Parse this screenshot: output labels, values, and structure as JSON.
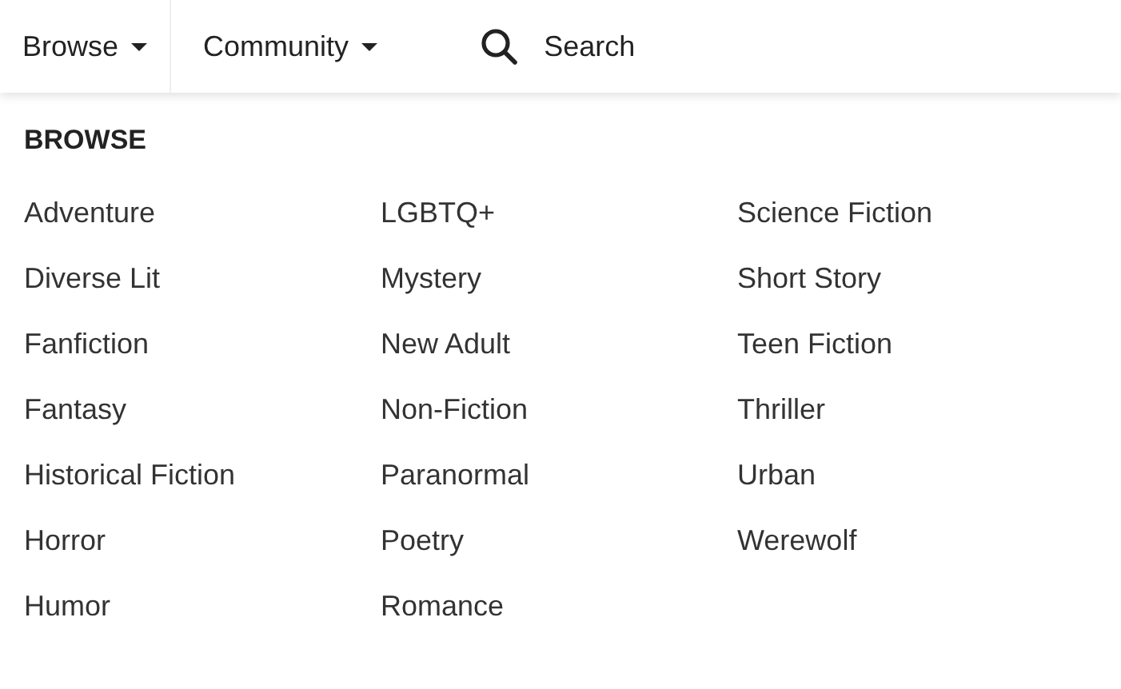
{
  "nav": {
    "tabs": [
      {
        "label": "Browse",
        "selected": true
      },
      {
        "label": "Community",
        "selected": false
      }
    ],
    "search": {
      "placeholder": "Search"
    }
  },
  "dropdown": {
    "heading": "BROWSE",
    "columns": [
      {
        "items": [
          "Adventure",
          "Diverse Lit",
          "Fanfiction",
          "Fantasy",
          "Historical Fiction",
          "Horror",
          "Humor"
        ]
      },
      {
        "items": [
          "LGBTQ+",
          "Mystery",
          "New Adult",
          "Non-Fiction",
          "Paranormal",
          "Poetry",
          "Romance"
        ]
      },
      {
        "items": [
          "Science Fiction",
          "Short Story",
          "Teen Fiction",
          "Thriller",
          "Urban",
          "Werewolf"
        ]
      }
    ]
  }
}
